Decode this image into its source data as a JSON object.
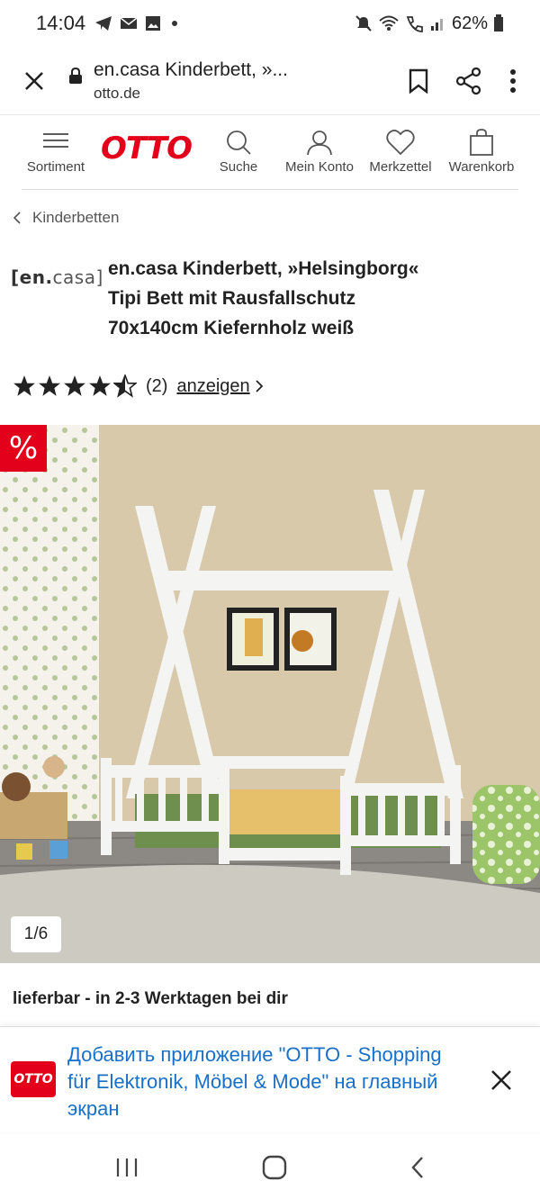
{
  "status_bar": {
    "time": "14:04",
    "battery": "62%"
  },
  "browser": {
    "page_title": "en.casa Kinderbett, »...",
    "domain": "otto.de"
  },
  "otto_header": {
    "menu_label": "Sortiment",
    "logo_text": "OTTO",
    "nav": [
      {
        "icon": "search-icon",
        "label": "Suche"
      },
      {
        "icon": "user-icon",
        "label": "Mein Konto"
      },
      {
        "icon": "heart-icon",
        "label": "Merkzettel"
      },
      {
        "icon": "bag-icon",
        "label": "Warenkorb"
      }
    ]
  },
  "breadcrumb": {
    "label": "Kinderbetten"
  },
  "product": {
    "brand_prefix": "[en.",
    "brand_suffix": "casa]",
    "title_line1": "en.casa Kinderbett, »Helsingborg«",
    "title_line2": "Tipi Bett mit Rausfallschutz",
    "title_line3": "70x140cm Kiefernholz weiß",
    "rating_value": 4.5,
    "rating_max": 5,
    "rating_count": "(2)",
    "rating_link": "anzeigen",
    "sale_badge": "%",
    "image_counter": "1/6",
    "availability": "lieferbar - in 2-3 Werktagen bei dir"
  },
  "app_banner": {
    "logo_text": "OTTO",
    "text": "Добавить приложение \"OTTO - Shopping für Elektronik, Möbel & Mode\" на главный экран"
  },
  "colors": {
    "brand_red": "#e3001b",
    "link_blue": "#1a6fc7",
    "wall": "#d8c9ab",
    "floor": "#8a8580"
  }
}
